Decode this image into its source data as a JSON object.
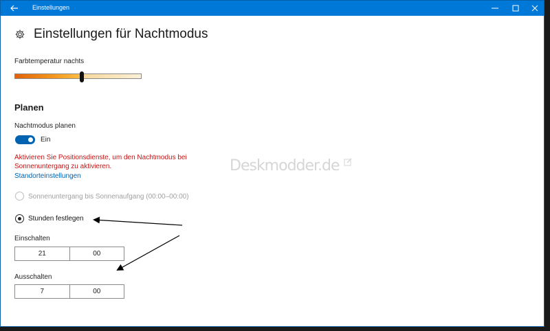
{
  "window": {
    "title": "Einstellungen"
  },
  "page": {
    "title": "Einstellungen für Nachtmodus"
  },
  "color_temperature": {
    "label": "Farbtemperatur nachts",
    "level_fraction": 0.53
  },
  "schedule": {
    "section_title": "Planen",
    "toggle_label": "Nachtmodus planen",
    "toggle_state": "Ein",
    "warning_line1": "Aktivieren Sie Positionsdienste, um den Nachtmodus bei",
    "warning_line2": "Sonnenuntergang zu aktivieren.",
    "location_link": "Standorteinstellungen",
    "option_sunset": "Sonnenuntergang bis Sonnenaufgang (00:00–00:00)",
    "option_hours": "Stunden festlegen",
    "on_label": "Einschalten",
    "on_hour": "21",
    "on_minute": "00",
    "off_label": "Ausschalten",
    "off_hour": "7",
    "off_minute": "00"
  },
  "watermark": "Deskmodder.de",
  "colors": {
    "accent": "#0078d7",
    "toggle": "#0063b1",
    "warning": "#c41414",
    "link": "#0063b1"
  },
  "icons": [
    "back-arrow-icon",
    "minimize-icon",
    "maximize-icon",
    "close-icon",
    "gear-icon",
    "edit-icon"
  ]
}
